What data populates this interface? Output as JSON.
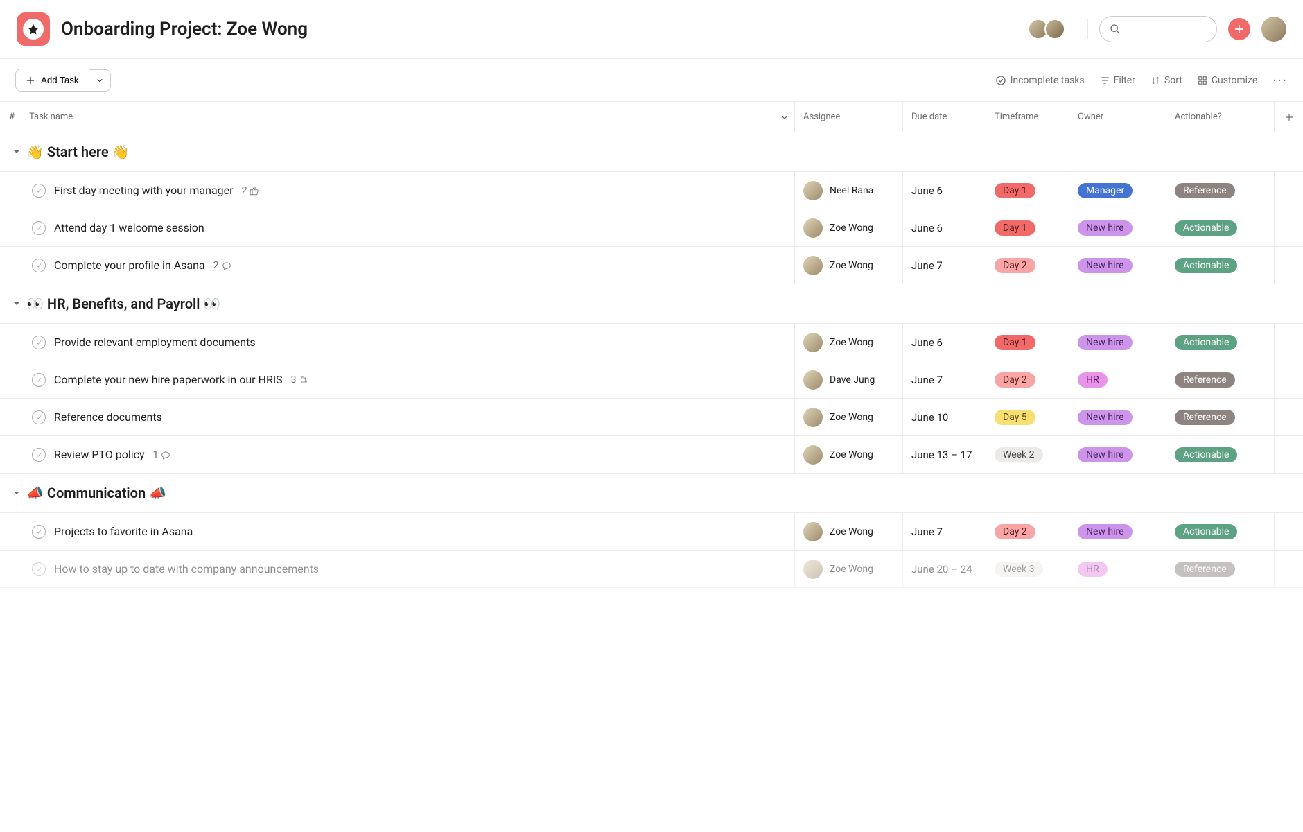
{
  "header": {
    "title": "Onboarding Project: Zoe Wong"
  },
  "toolbar": {
    "add_task": "Add Task",
    "incomplete": "Incomplete tasks",
    "filter": "Filter",
    "sort": "Sort",
    "customize": "Customize"
  },
  "columns": {
    "num": "#",
    "name": "Task name",
    "assignee": "Assignee",
    "due": "Due date",
    "timeframe": "Timeframe",
    "owner": "Owner",
    "actionable": "Actionable?"
  },
  "pills": {
    "day1": {
      "label": "Day 1",
      "bg": "#f06a6a",
      "fg": "#5a1818"
    },
    "day2": {
      "label": "Day 2",
      "bg": "#f8a5a5",
      "fg": "#5a1818"
    },
    "day5": {
      "label": "Day 5",
      "bg": "#f8df72",
      "fg": "#5a4a18"
    },
    "week2": {
      "label": "Week 2",
      "bg": "#eceae8",
      "fg": "#444"
    },
    "week3": {
      "label": "Week 3",
      "bg": "#eceae8",
      "fg": "#444"
    },
    "manager": {
      "label": "Manager",
      "bg": "#4573d2",
      "fg": "#fff"
    },
    "newhire": {
      "label": "New hire",
      "bg": "#cd95ea",
      "fg": "#4a2360"
    },
    "hr": {
      "label": "HR",
      "bg": "#e894e8",
      "fg": "#5a1a5a"
    },
    "reference": {
      "label": "Reference",
      "bg": "#8d8480",
      "fg": "#fff"
    },
    "actionable": {
      "label": "Actionable",
      "bg": "#5da283",
      "fg": "#fff"
    }
  },
  "sections": [
    {
      "title": "👋 Start here 👋",
      "tasks": [
        {
          "name": "First day meeting with your manager",
          "meta_count": "2",
          "meta_type": "like",
          "assignee": "Neel Rana",
          "due": "June 6",
          "timeframe": "day1",
          "owner": "manager",
          "actionable": "reference"
        },
        {
          "name": "Attend day 1 welcome session",
          "assignee": "Zoe Wong",
          "due": "June 6",
          "timeframe": "day1",
          "owner": "newhire",
          "actionable": "actionable"
        },
        {
          "name": "Complete your profile in Asana",
          "meta_count": "2",
          "meta_type": "comment",
          "assignee": "Zoe Wong",
          "due": "June 7",
          "timeframe": "day2",
          "owner": "newhire",
          "actionable": "actionable"
        }
      ]
    },
    {
      "title": "👀 HR, Benefits, and Payroll 👀",
      "tasks": [
        {
          "name": "Provide relevant employment documents",
          "assignee": "Zoe Wong",
          "due": "June 6",
          "timeframe": "day1",
          "owner": "newhire",
          "actionable": "actionable"
        },
        {
          "name": "Complete your new hire paperwork in our HRIS",
          "meta_count": "3",
          "meta_type": "subtask",
          "assignee": "Dave Jung",
          "due": "June 7",
          "timeframe": "day2",
          "owner": "hr",
          "actionable": "reference"
        },
        {
          "name": "Reference documents",
          "assignee": "Zoe Wong",
          "due": "June 10",
          "timeframe": "day5",
          "owner": "newhire",
          "actionable": "reference"
        },
        {
          "name": "Review PTO policy",
          "meta_count": "1",
          "meta_type": "comment",
          "assignee": "Zoe Wong",
          "due": "June 13 – 17",
          "timeframe": "week2",
          "owner": "newhire",
          "actionable": "actionable"
        }
      ]
    },
    {
      "title": "📣 Communication 📣",
      "tasks": [
        {
          "name": "Projects to favorite in Asana",
          "assignee": "Zoe Wong",
          "due": "June 7",
          "timeframe": "day2",
          "owner": "newhire",
          "actionable": "actionable"
        },
        {
          "name": "How to stay up to date with company announcements",
          "assignee": "Zoe Wong",
          "due": "June 20 – 24",
          "timeframe": "week3",
          "owner": "hr",
          "actionable": "reference",
          "faded": true
        }
      ]
    }
  ]
}
